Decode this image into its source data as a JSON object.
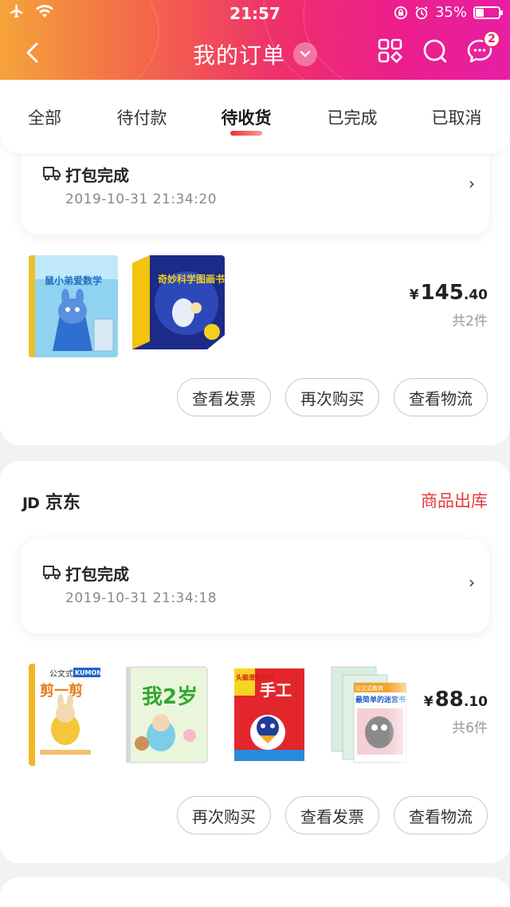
{
  "status_bar": {
    "time": "21:57",
    "battery": "35%",
    "battery_level": 0.35
  },
  "nav": {
    "title": "我的订单",
    "message_badge": "2"
  },
  "tabs": [
    {
      "label": "全部",
      "active": false
    },
    {
      "label": "待付款",
      "active": false
    },
    {
      "label": "待收货",
      "active": true
    },
    {
      "label": "已完成",
      "active": false
    },
    {
      "label": "已取消",
      "active": false
    }
  ],
  "orders": [
    {
      "tracking": {
        "title": "打包完成",
        "time": "2019-10-31 21:34:20"
      },
      "price": {
        "yen": "¥",
        "integer": "145",
        "cents": ".40"
      },
      "count": "共2件",
      "products": [
        {
          "title": "鼠小弟爱数学"
        },
        {
          "title": "奇妙科学图画书"
        }
      ],
      "actions": [
        "查看发票",
        "再次购买",
        "查看物流"
      ]
    },
    {
      "shop": {
        "logo": "JD",
        "name": "京东"
      },
      "status": "商品出库",
      "tracking": {
        "title": "打包完成",
        "time": "2019-10-31 21:34:18"
      },
      "price": {
        "yen": "¥",
        "integer": "88",
        "cents": ".10"
      },
      "count": "共6件",
      "products": [
        {
          "brand": "公文式教育",
          "brand2": "KUMON",
          "title": "剪一剪"
        },
        {
          "title": "我2岁"
        },
        {
          "title": "手工",
          "tag": "头脑潜能开发"
        },
        {
          "brand": "公文式教育",
          "title": "最简单的迷宫书"
        }
      ],
      "actions": [
        "再次购买",
        "查看发票",
        "查看物流"
      ]
    }
  ],
  "colors": {
    "accent": "#e4393c",
    "header_start": "#f6a33a",
    "header_end": "#e81ea4"
  }
}
